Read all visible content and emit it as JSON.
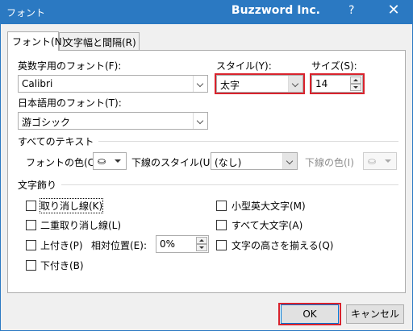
{
  "window": {
    "title_left": "フォント",
    "title_right": "Buzzword Inc.",
    "help": "?",
    "close": "✕"
  },
  "tabs": [
    {
      "label": "フォント(N)"
    },
    {
      "label": "文字幅と間隔(R)"
    }
  ],
  "latin_font": {
    "label": "英数字用のフォント(F):",
    "value": "Calibri"
  },
  "style": {
    "label": "スタイル(Y):",
    "value": "太字"
  },
  "size": {
    "label": "サイズ(S):",
    "value": "14"
  },
  "jp_font": {
    "label": "日本語用のフォント(T):",
    "value": "游ゴシック"
  },
  "all_text": {
    "title": "すべてのテキスト",
    "font_color_label": "フォントの色(C)",
    "underline_style_label": "下線のスタイル(U)",
    "underline_style_value": "(なし)",
    "underline_color_label": "下線の色(I)",
    "icon_name": "paint-bucket-icon"
  },
  "effects": {
    "title": "文字飾り",
    "items": [
      {
        "label": "取り消し線(K)",
        "checked": false
      },
      {
        "label": "二重取り消し線(L)",
        "checked": false
      },
      {
        "label": "上付き(P)",
        "checked": false
      },
      {
        "label": "下付き(B)",
        "checked": false
      },
      {
        "label": "小型英大文字(M)",
        "checked": false
      },
      {
        "label": "すべて大文字(A)",
        "checked": false
      },
      {
        "label": "文字の高さを揃える(Q)",
        "checked": false
      }
    ],
    "offset_label": "相対位置(E):",
    "offset_value": "0%"
  },
  "buttons": {
    "ok": "OK",
    "cancel": "キャンセル"
  },
  "colors": {
    "titlebar": "#2b79c2",
    "highlight": "#d9232d",
    "dialog_bg": "#f0f0f0"
  }
}
